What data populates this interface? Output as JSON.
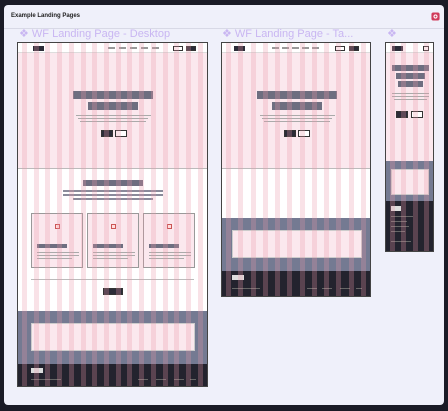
{
  "panel": {
    "title": "Example Landing Pages",
    "icon": "figma-plugin-icon"
  },
  "frames": [
    {
      "label": "❖ WF Landing Page - Desktop"
    },
    {
      "label": "❖ WF Landing Page - Ta..."
    },
    {
      "label": "❖"
    }
  ]
}
